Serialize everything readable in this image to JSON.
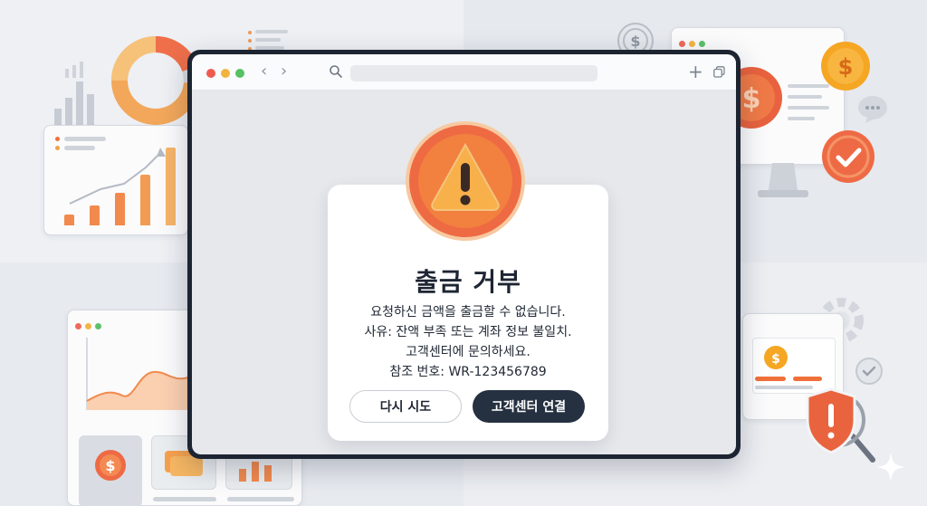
{
  "browser": {
    "window_dots": [
      "#ef5a4f",
      "#f2b33d",
      "#55c064"
    ],
    "nav_back": "‹",
    "nav_forward": "›",
    "new_tab": "+"
  },
  "dialog": {
    "icon": "warning-icon",
    "title": "출금 거부",
    "message_lines": [
      "요청하신 금액을 출금할 수 없습니다.",
      "사유: 잔액 부족 또는 계좌 정보 불일치.",
      "고객센터에 문의하세요.",
      "참조 번호: WR-123456789"
    ],
    "retry_button": "다시 시도",
    "contact_button": "고객센터 연결"
  },
  "colors": {
    "accent": "#f0703a",
    "warning": "#f5a623",
    "dark_button": "#253040",
    "frame": "#1d2431"
  }
}
